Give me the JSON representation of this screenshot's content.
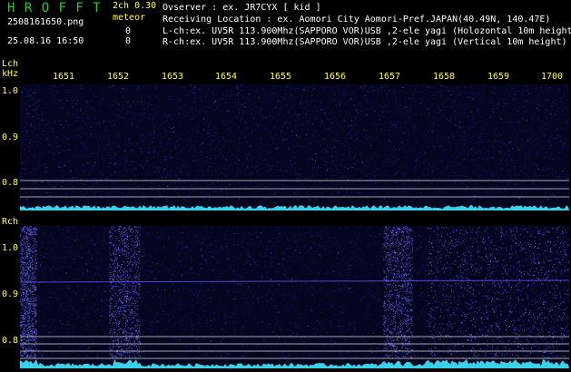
{
  "app": {
    "title": "H R O F F T",
    "version": "2ch 0.30"
  },
  "file": {
    "name": "2508161650.png",
    "datetime": "25.08.16 16:50"
  },
  "meteor": {
    "label": "meteor",
    "lch_count": "0",
    "rch_count": "0"
  },
  "info": {
    "observer": "Ovserver           : ex. JR7CYX [ kid ]",
    "location": "Receiving Location : ex. Aomori City Aomori-Pref.JAPAN(40.49N, 140.47E)",
    "lch": "L-ch:ex. UV5R 113.900Mhz(SAPPORO VOR)USB ,2-ele yagi (Holozontal 10m height",
    "rch": "R-ch:ex. UV5R 113.900Mhz(SAPPORO VOR)USB ,2-ele yagi (Vertical 10m height)"
  },
  "axis": {
    "lch_label": "Lch",
    "unit": "kHz",
    "rch_label": "Rch",
    "time_ticks": [
      "1651",
      "1652",
      "1653",
      "1654",
      "1655",
      "1656",
      "1657",
      "1658",
      "1659",
      "1700"
    ],
    "lch_freq_ticks": [
      "1.0",
      "0.9",
      "0.8"
    ],
    "rch_freq_ticks": [
      "1.0",
      "0.9",
      "0.8"
    ]
  },
  "colors": {
    "background": "#000000",
    "title": "#2ec82e",
    "label": "#ffff33",
    "text": "#ffffff",
    "spectrum": "#1010a0",
    "signal": "#40e8ff"
  }
}
